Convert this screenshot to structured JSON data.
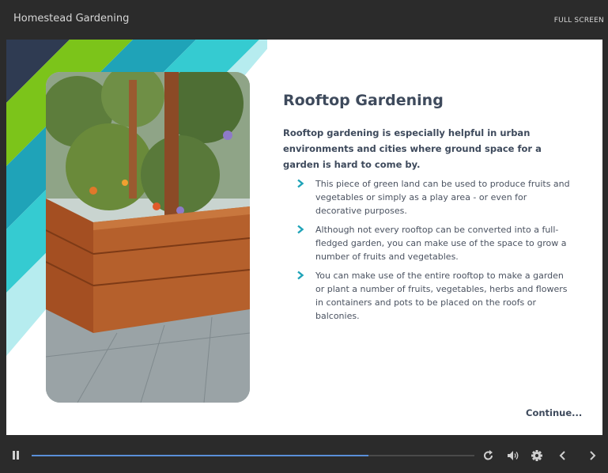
{
  "header": {
    "course_title": "Homestead Gardening",
    "fullscreen_label": "FULL SCREEN"
  },
  "slide": {
    "title": "Rooftop Gardening",
    "intro": "Rooftop gardening is especially helpful in urban environments and cities where ground space for a garden is hard to come by.",
    "bullets": [
      "This piece of green land can be used to produce fruits and vegetables or simply as a play area - or even for decorative purposes.",
      "Although not every rooftop can be converted into a full-fledged garden, you can make use of the space to grow a number of fruits and vegetables.",
      "You can make use of the entire rooftop to make a garden or plant a number of fruits, vegetables, herbs and flowers in containers and pots to be placed on the roofs or balconies."
    ],
    "continue_label": "Continue...",
    "image_subject": "wooden raised garden bed on rooftop deck"
  },
  "player": {
    "progress": 0.76,
    "controls": [
      "pause-icon",
      "replay-icon",
      "volume-icon",
      "gear-icon",
      "chevron-left-icon",
      "chevron-right-icon"
    ]
  },
  "colors": {
    "accent_teal": "#1fa3b8",
    "stripe_green": "#7cc41a",
    "stripe_cyan": "#35cbd1",
    "stripe_navy": "#2f3b52",
    "progress_blue": "#5a8fd8",
    "text_dark": "#3e4a5c"
  }
}
